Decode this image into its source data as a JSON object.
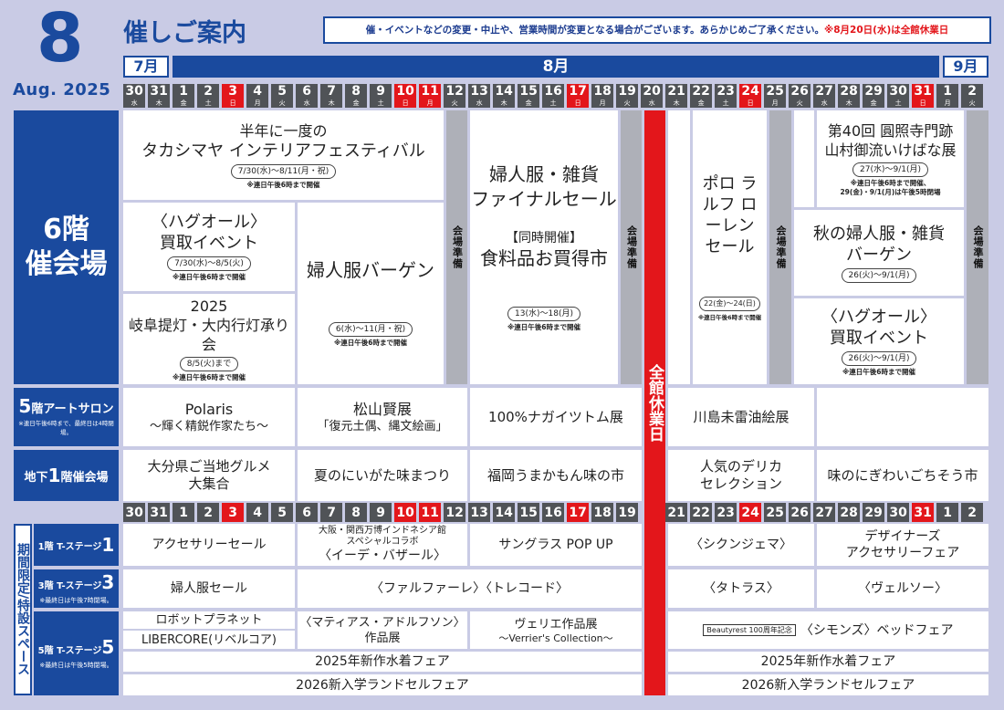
{
  "header": {
    "month_number": "8",
    "month_en": "Aug. 2025",
    "title": "催しご案内",
    "notice": "催・イベントなどの変更・中止や、営業時間が変更となる場合がございます。あらかじめご了承ください。",
    "notice_red": "※8月20日(水)は全館休業日"
  },
  "months": {
    "jul": "7月",
    "aug": "8月",
    "sep": "9月"
  },
  "days": [
    {
      "n": "30",
      "w": "水"
    },
    {
      "n": "31",
      "w": "木"
    },
    {
      "n": "1",
      "w": "金"
    },
    {
      "n": "2",
      "w": "土"
    },
    {
      "n": "3",
      "w": "日",
      "red": true
    },
    {
      "n": "4",
      "w": "月"
    },
    {
      "n": "5",
      "w": "火"
    },
    {
      "n": "6",
      "w": "水"
    },
    {
      "n": "7",
      "w": "木"
    },
    {
      "n": "8",
      "w": "金"
    },
    {
      "n": "9",
      "w": "土"
    },
    {
      "n": "10",
      "w": "日",
      "red": true
    },
    {
      "n": "11",
      "w": "月",
      "red": true
    },
    {
      "n": "12",
      "w": "火"
    },
    {
      "n": "13",
      "w": "水"
    },
    {
      "n": "14",
      "w": "木"
    },
    {
      "n": "15",
      "w": "金"
    },
    {
      "n": "16",
      "w": "土"
    },
    {
      "n": "17",
      "w": "日",
      "red": true
    },
    {
      "n": "18",
      "w": "月"
    },
    {
      "n": "19",
      "w": "火"
    },
    {
      "n": "20",
      "w": "水"
    },
    {
      "n": "21",
      "w": "木"
    },
    {
      "n": "22",
      "w": "金"
    },
    {
      "n": "23",
      "w": "土"
    },
    {
      "n": "24",
      "w": "日",
      "red": true
    },
    {
      "n": "25",
      "w": "月"
    },
    {
      "n": "26",
      "w": "火"
    },
    {
      "n": "27",
      "w": "水"
    },
    {
      "n": "28",
      "w": "木"
    },
    {
      "n": "29",
      "w": "金"
    },
    {
      "n": "30",
      "w": "土"
    },
    {
      "n": "31",
      "w": "日",
      "red": true
    },
    {
      "n": "1",
      "w": "月"
    },
    {
      "n": "2",
      "w": "火"
    }
  ],
  "days2": [
    {
      "n": "30"
    },
    {
      "n": "31"
    },
    {
      "n": "1"
    },
    {
      "n": "2"
    },
    {
      "n": "3",
      "red": true
    },
    {
      "n": "4"
    },
    {
      "n": "5"
    },
    {
      "n": "6"
    },
    {
      "n": "7"
    },
    {
      "n": "8"
    },
    {
      "n": "9"
    },
    {
      "n": "10",
      "red": true
    },
    {
      "n": "11",
      "red": true
    },
    {
      "n": "12"
    },
    {
      "n": "13"
    },
    {
      "n": "14"
    },
    {
      "n": "15"
    },
    {
      "n": "16"
    },
    {
      "n": "17",
      "red": true
    },
    {
      "n": "18"
    },
    {
      "n": "19"
    },
    {
      "gap": true
    },
    {
      "n": "21"
    },
    {
      "n": "22"
    },
    {
      "n": "23"
    },
    {
      "n": "24",
      "red": true
    },
    {
      "n": "25"
    },
    {
      "n": "26"
    },
    {
      "n": "27"
    },
    {
      "n": "28"
    },
    {
      "n": "29"
    },
    {
      "n": "30"
    },
    {
      "n": "31",
      "red": true
    },
    {
      "n": "1"
    },
    {
      "n": "2"
    }
  ],
  "side": {
    "f6_a": "6階",
    "f6_b": "催会場",
    "f5_a": "5",
    "f5_b": "階アートサロン",
    "f5_note": "※連日午後6時まで、最終日は4時閉場。",
    "b1_a": "地下",
    "b1_b": "1",
    "b1_c": "階催会場",
    "limited": "期間限定/特設スペース",
    "s1_a": "1階 T-ステージ",
    "s1_b": "1",
    "s3_a": "3階 T-ステージ",
    "s3_b": "3",
    "s3_note": "※最終日は午後7時閉場。",
    "s5_a": "5階 T-ステージ",
    "s5_b": "5",
    "s5_note": "※最終日は午後5時閉場。"
  },
  "f6": {
    "interior_1": "半年に一度の",
    "interior_2": "タカシマヤ インテリアフェスティバル",
    "interior_date": "7/30(水)～8/11(月・祝)",
    "interior_note": "※連日午後6時まで開催",
    "hug1_1": "〈ハグオール〉",
    "hug1_2": "買取イベント",
    "hug1_date": "7/30(水)～8/5(火)",
    "hug1_note": "※連日午後6時まで開催",
    "gifu_1": "2025",
    "gifu_2": "岐阜提灯・大内行灯承り会",
    "gifu_date": "8/5(火)まで",
    "gifu_note": "※連日午後6時まで開催",
    "bargain": "婦人服バーゲン",
    "bargain_date": "6(水)～11(月・祝)",
    "bargain_note": "※連日午後6時まで開催",
    "prep": "会場準備",
    "final_1": "婦人服・雑貨",
    "final_2": "ファイナルセール",
    "final_3": "【同時開催】",
    "final_4": "食料品お買得市",
    "final_date": "13(水)～18(月)",
    "final_note": "※連日午後6時まで開催",
    "closed": "全館休業日",
    "polo": "ポロ ラルフ ローレン セール",
    "polo_date": "22(金)～24(日)",
    "polo_note": "※連日午後6時まで開催",
    "ike_1": "第40回 圓照寺門跡",
    "ike_2": "山村御流いけばな展",
    "ike_date": "27(水)～9/1(月)",
    "ike_note1": "※連日午後6時まで開催、",
    "ike_note2": "29(金)・9/1(月)は午後5時閉場",
    "autumn_1": "秋の婦人服・雑貨",
    "autumn_2": "バーゲン",
    "autumn_date": "26(火)～9/1(月)",
    "hug2_1": "〈ハグオール〉",
    "hug2_2": "買取イベント",
    "hug2_date": "26(火)～9/1(月)",
    "hug2_note": "※連日午後6時まで開催"
  },
  "f5": {
    "polaris_1": "Polaris",
    "polaris_2": "～輝く精鋭作家たち～",
    "matsu_1": "松山賢展",
    "matsu_2": "「復元土偶、縄文絵画」",
    "nagai": "100%ナガイツトム展",
    "kawa": "川島未雷油絵展"
  },
  "b1": {
    "oita_1": "大分県ご当地グルメ",
    "oita_2": "大集合",
    "niigata": "夏のにいがた味まつり",
    "fukuoka": "福岡うまかもん味の市",
    "deli_1": "人気のデリカ",
    "deli_2": "セレクション",
    "nigi": "味のにぎわいごちそう市"
  },
  "s1": {
    "acc": "アクセサリーセール",
    "osaka_1": "大阪・関西万博インドネシア館",
    "osaka_2": "スペシャルコラボ",
    "osaka_3": "〈イーデ・バザール〉",
    "sun": "サングラス POP UP",
    "shiku": "〈シクンジェマ〉",
    "des_1": "デザイナーズ",
    "des_2": "アクセサリーフェア"
  },
  "s3": {
    "fujin": "婦人服セール",
    "farfa": "〈ファルファーレ〉〈トレコード〉",
    "tatras": "〈タトラス〉",
    "vel": "〈ヴェルソー〉"
  },
  "s5": {
    "robot": "ロボットプラネット",
    "liber": "LIBERCORE(リベルコア)",
    "mati_1": "〈マティアス・アドルフソン〉",
    "mati_2": "作品展",
    "veri_1": "ヴェリエ作品展",
    "veri_2": "～Verrier's Collection～",
    "beauty_tag": "Beautyrest 100周年記念",
    "beauty": "〈シモンズ〉ベッドフェア",
    "swim": "2025年新作水着フェア",
    "swim2": "2025年新作水着フェア",
    "rand": "2026新入学ランドセルフェア",
    "rand2": "2026新入学ランドセルフェア"
  }
}
